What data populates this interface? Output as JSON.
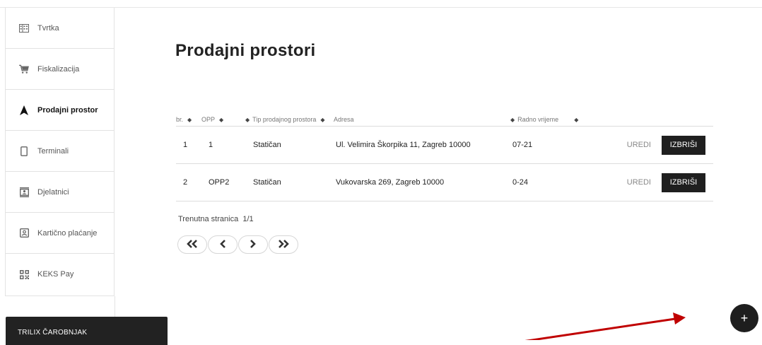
{
  "sidebar": {
    "items": [
      {
        "label": "Tvrtka",
        "icon": "building-icon",
        "active": false
      },
      {
        "label": "Fiskalizacija",
        "icon": "cart-icon",
        "active": false
      },
      {
        "label": "Prodajni prostor",
        "icon": "navigation-arrow-icon",
        "active": true
      },
      {
        "label": "Terminali",
        "icon": "phone-icon",
        "active": false
      },
      {
        "label": "Djelatnici",
        "icon": "contact-card-icon",
        "active": false
      },
      {
        "label": "Kartično plaćanje",
        "icon": "card-terminal-icon",
        "active": false
      },
      {
        "label": "KEKS Pay",
        "icon": "qr-code-icon",
        "active": false
      }
    ]
  },
  "main": {
    "title": "Prodajni prostori",
    "table": {
      "columns": [
        "br.",
        "OPP",
        "Tip prodajnog prostora",
        "Adresa",
        "Radno vrijeme"
      ],
      "rows": [
        {
          "br": "1",
          "opp": "1",
          "tip": "Statičan",
          "adresa": "Ul. Velimira Škorpika 11, Zagreb 10000",
          "radno_vrijeme": "07-21"
        },
        {
          "br": "2",
          "opp": "OPP2",
          "tip": "Statičan",
          "adresa": "Vukovarska 269, Zagreb 10000",
          "radno_vrijeme": "0-24"
        }
      ],
      "edit_label": "UREDI",
      "delete_label": "IZBRIŠI"
    },
    "pagination": {
      "label": "Trenutna stranica",
      "current": "1/1",
      "buttons": [
        "first-page-icon",
        "prev-page-icon",
        "next-page-icon",
        "last-page-icon"
      ]
    }
  },
  "wizard": {
    "label": "TRILIX ČAROBNJAK"
  },
  "fab": {
    "label": "+"
  },
  "colors": {
    "accent": "#1f1f1f",
    "annotation_arrow": "#c00000",
    "border": "#e3e3e3"
  }
}
